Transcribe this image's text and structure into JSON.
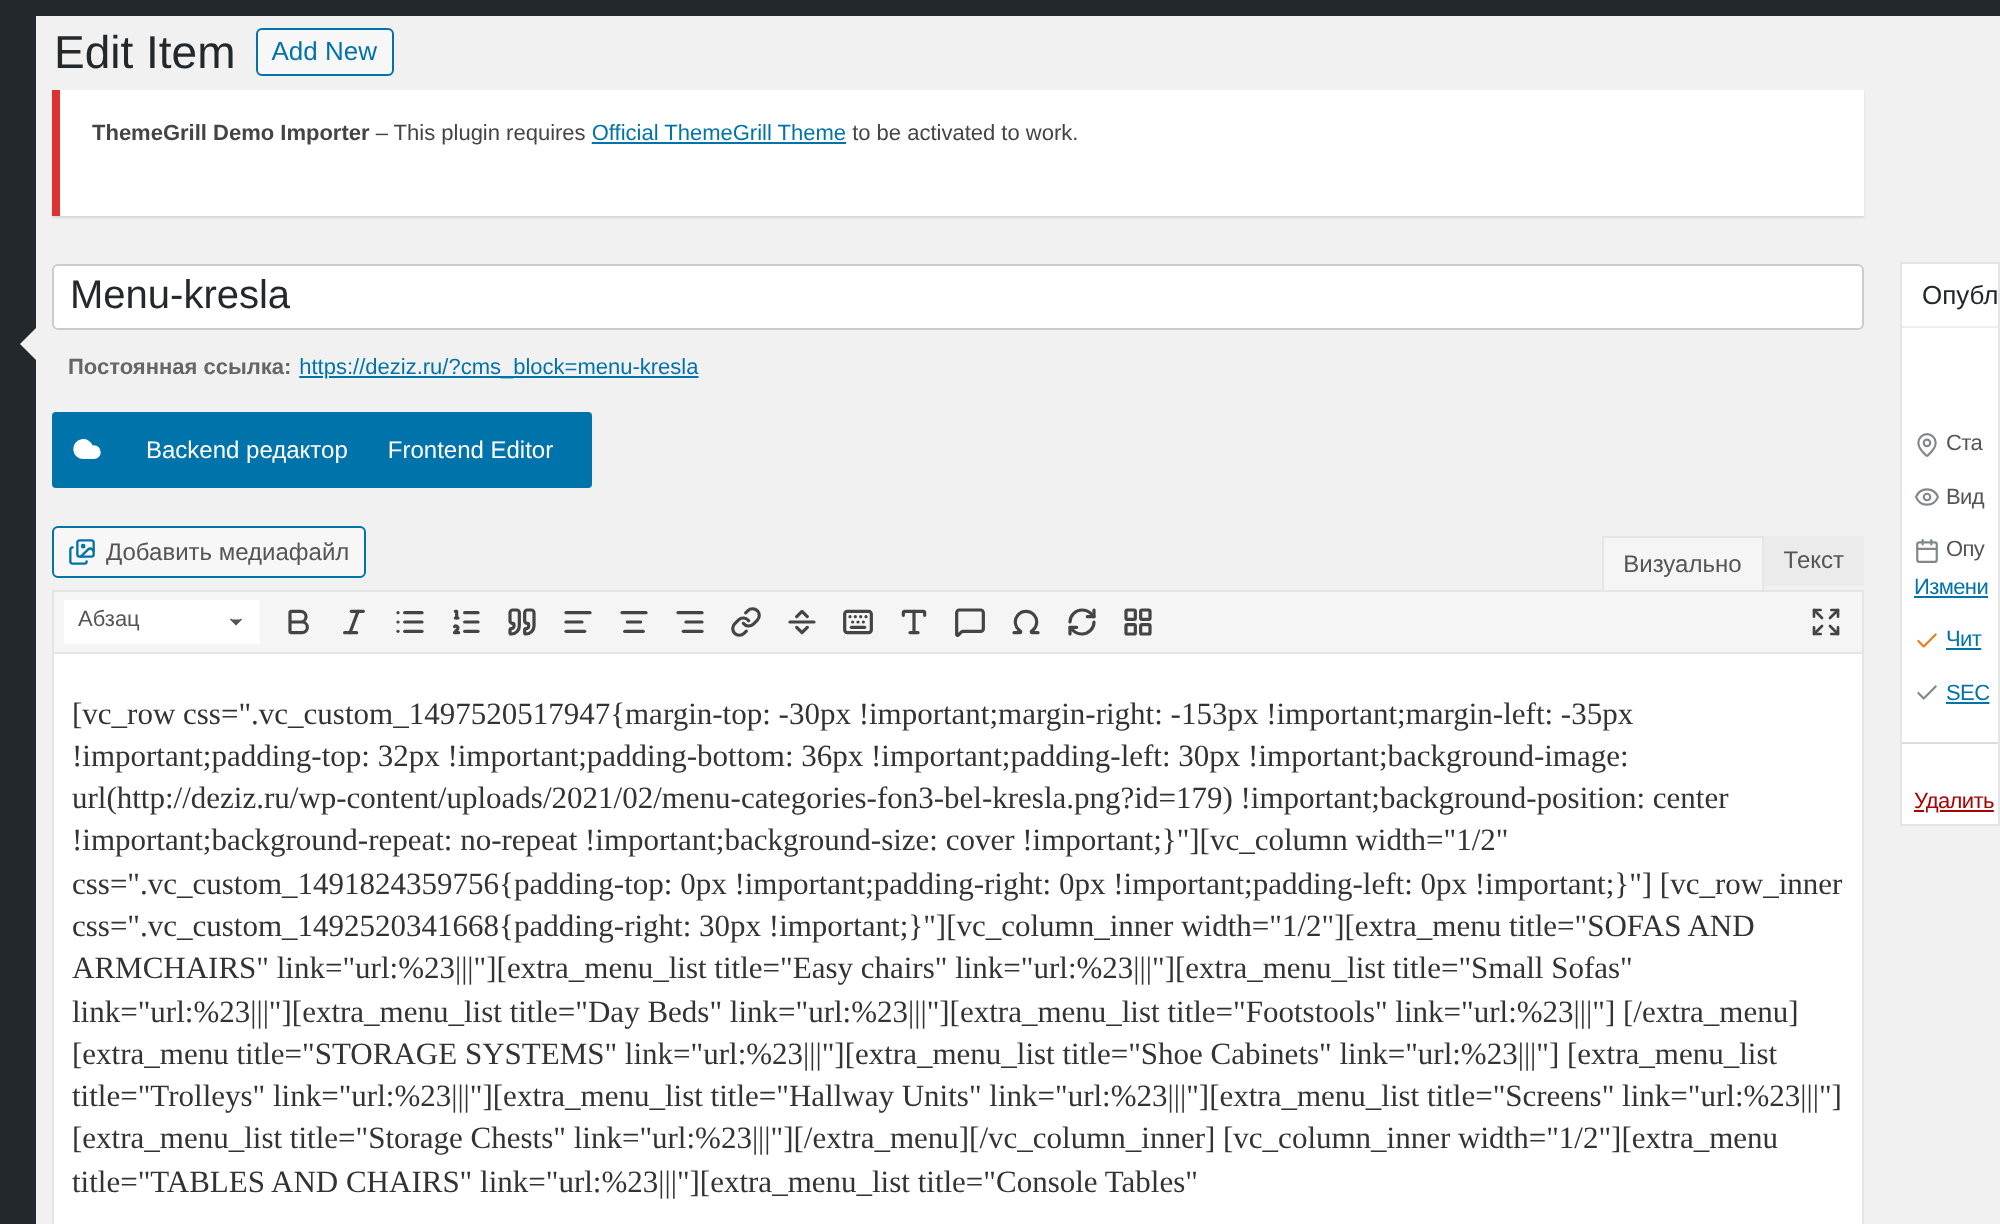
{
  "page": {
    "title": "Edit Item",
    "add_new": "Add New"
  },
  "notice": {
    "plugin": "ThemeGrill Demo Importer",
    "text_before": " – This plugin requires ",
    "link": "Official ThemeGrill Theme",
    "text_after": " to be activated to work."
  },
  "title_field": {
    "value": "Menu-kresla"
  },
  "permalink": {
    "label": "Постоянная ссылка:",
    "url": "https://deziz.ru/?cms_block=menu-kresla"
  },
  "builder_buttons": [
    "Backend редактор",
    "Frontend Editor"
  ],
  "add_media": "Добавить медиафайл",
  "editor_tabs": [
    {
      "label": "Визуально",
      "selected": true
    },
    {
      "label": "Текст",
      "selected": false
    }
  ],
  "format_select": "Абзац",
  "toolbar": [
    {
      "kind": "bold"
    },
    {
      "kind": "italic"
    },
    {
      "kind": "bullets"
    },
    {
      "kind": "numbers"
    },
    {
      "kind": "quote"
    },
    {
      "kind": "align-left"
    },
    {
      "kind": "align-center"
    },
    {
      "kind": "align-right"
    },
    {
      "kind": "link"
    },
    {
      "kind": "more"
    },
    {
      "kind": "toolbar"
    },
    {
      "kind": "font"
    },
    {
      "kind": "chat"
    },
    {
      "kind": "omega"
    },
    {
      "kind": "refresh"
    },
    {
      "kind": "grid"
    }
  ],
  "content": "[vc_row css=\".vc_custom_1497520517947{margin-top: -30px !important;margin-right: -153px !important;margin-left: -35px !important;padding-top: 32px !important;padding-bottom: 36px !important;padding-left: 30px !important;background-image: url(http://deziz.ru/wp-content/uploads/2021/02/menu-categories-fon3-bel-kresla.png?id=179) !important;background-position: center !important;background-repeat: no-repeat !important;background-size: cover !important;}\"][vc_column width=\"1/2\" css=\".vc_custom_1491824359756{padding-top: 0px !important;padding-right: 0px !important;padding-left: 0px !important;}\"] [vc_row_inner css=\".vc_custom_1492520341668{padding-right: 30px !important;}\"][vc_column_inner width=\"1/2\"][extra_menu title=\"SOFAS AND ARMCHAIRS\" link=\"url:%23|||\"][extra_menu_list title=\"Easy chairs\" link=\"url:%23|||\"][extra_menu_list title=\"Small Sofas\" link=\"url:%23|||\"][extra_menu_list title=\"Day Beds\" link=\"url:%23|||\"][extra_menu_list title=\"Footstools\" link=\"url:%23|||\"] [/extra_menu][extra_menu title=\"STORAGE SYSTEMS\" link=\"url:%23|||\"][extra_menu_list title=\"Shoe Cabinets\" link=\"url:%23|||\"] [extra_menu_list title=\"Trolleys\" link=\"url:%23|||\"][extra_menu_list title=\"Hallway Units\" link=\"url:%23|||\"][extra_menu_list title=\"Screens\" link=\"url:%23|||\"][extra_menu_list title=\"Storage Chests\" link=\"url:%23|||\"][/extra_menu][/vc_column_inner] [vc_column_inner width=\"1/2\"][extra_menu title=\"TABLES AND CHAIRS\" link=\"url:%23|||\"][extra_menu_list title=\"Console Tables\"",
  "publish_box": {
    "title": "Опубл",
    "items": [
      {
        "kind": "status",
        "text": "Ста"
      },
      {
        "kind": "visibility",
        "text": "Вид"
      },
      {
        "kind": "date",
        "text": "Опу"
      },
      {
        "kind": "edit-link",
        "text": "Измени"
      },
      {
        "kind": "readability",
        "text": "Чит"
      },
      {
        "kind": "seo",
        "text": "SEC"
      }
    ],
    "delete": "Удалить"
  }
}
